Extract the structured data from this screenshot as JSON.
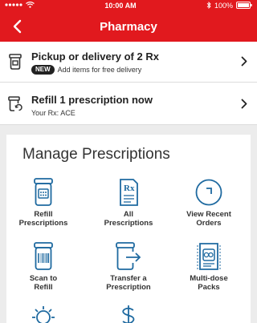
{
  "status_bar": {
    "time": "10:00 AM",
    "battery": "100%"
  },
  "header": {
    "title": "Pharmacy"
  },
  "rows": [
    {
      "title": "Pickup or delivery of 2 Rx",
      "badge": "NEW",
      "subtitle": "Add items for free delivery",
      "icon": "pill-bottle-icon"
    },
    {
      "title": "Refill 1 prescription now",
      "subtitle": "Your Rx: ACE",
      "icon": "refill-bottle-icon"
    }
  ],
  "manage": {
    "title": "Manage Prescriptions",
    "tiles": [
      {
        "label": "Refill\nPrescriptions",
        "icon": "refill-prescriptions-icon"
      },
      {
        "label": "All\nPrescriptions",
        "icon": "all-prescriptions-icon"
      },
      {
        "label": "View Recent\nOrders",
        "icon": "recent-orders-icon"
      },
      {
        "label": "Scan to\nRefill",
        "icon": "scan-barcode-icon"
      },
      {
        "label": "Transfer a\nPrescription",
        "icon": "transfer-prescription-icon"
      },
      {
        "label": "Multi-dose\nPacks",
        "icon": "multi-dose-pack-icon"
      }
    ]
  },
  "colors": {
    "brand": "#e1191e",
    "icon": "#1f6aa0"
  }
}
